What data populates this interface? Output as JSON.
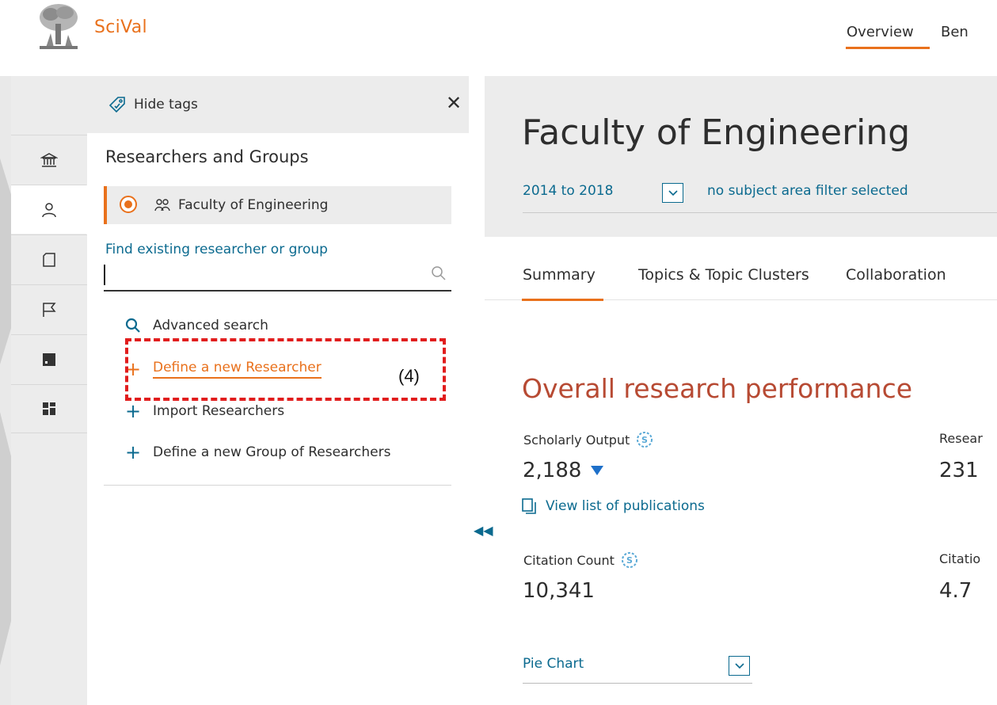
{
  "header": {
    "brand": "SciVal",
    "nav": [
      {
        "label": "Overview",
        "active": true
      },
      {
        "label": "Ben"
      }
    ]
  },
  "rail": {
    "items": [
      {
        "icon": "institution-icon"
      },
      {
        "icon": "person-icon",
        "active": true
      },
      {
        "icon": "publication-icon"
      },
      {
        "icon": "flag-icon"
      },
      {
        "icon": "chart-icon"
      },
      {
        "icon": "grid-icon"
      }
    ]
  },
  "panel": {
    "hide_tags": "Hide tags",
    "title": "Researchers and Groups",
    "selected_entity": "Faculty of Engineering",
    "find_label": "Find existing researcher or group",
    "search_value": "",
    "links": {
      "advanced_search": "Advanced search",
      "define_researcher": "Define a new Researcher",
      "import_researchers": "Import Researchers",
      "define_group": "Define a new Group of Researchers"
    },
    "annotation": "(4)"
  },
  "main": {
    "title": "Faculty of Engineering",
    "year_range": "2014 to 2018",
    "subject_filter": "no subject area filter selected",
    "tabs": [
      {
        "label": "Summary",
        "active": true
      },
      {
        "label": "Topics & Topic Clusters"
      },
      {
        "label": "Collaboration"
      }
    ],
    "section_title": "Overall research performance",
    "metrics": {
      "scholarly_output_label": "Scholarly Output",
      "scholarly_output_value": "2,188",
      "researchers_label": "Resear",
      "researchers_value": "231",
      "view_list": "View list of publications",
      "citation_count_label": "Citation Count",
      "citation_count_value": "10,341",
      "citations_per_label": "Citatio",
      "citations_per_value": "4.7"
    },
    "chart_selector": "Pie Chart"
  },
  "colors": {
    "accent": "#e9711c",
    "link": "#0b6a8f",
    "section": "#b74a33",
    "annotation": "#e11d1d"
  }
}
